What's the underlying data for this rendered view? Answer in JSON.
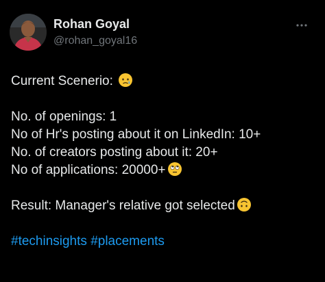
{
  "colors": {
    "background": "#000000",
    "text": "#e7e9ea",
    "secondary_text": "#71767b",
    "link": "#1d9bf0"
  },
  "author": {
    "name": "Rohan Goyal",
    "handle": "@rohan_goyal16"
  },
  "more_icon": "more-horizontal-icon",
  "post": {
    "line1": "Current Scenerio: ",
    "line1_emoji": "😢",
    "line2": "No. of openings: 1",
    "line3": "No of Hr's posting about it on LinkedIn: 10+",
    "line4": "No. of creators posting about it: 20+",
    "line5": "No of applications: 20000+",
    "line5_emoji": "🙄",
    "line6": "Result: Manager's relative got selected",
    "line6_emoji": "🙃",
    "hashtags": [
      "#techinsights",
      "#placements"
    ]
  }
}
